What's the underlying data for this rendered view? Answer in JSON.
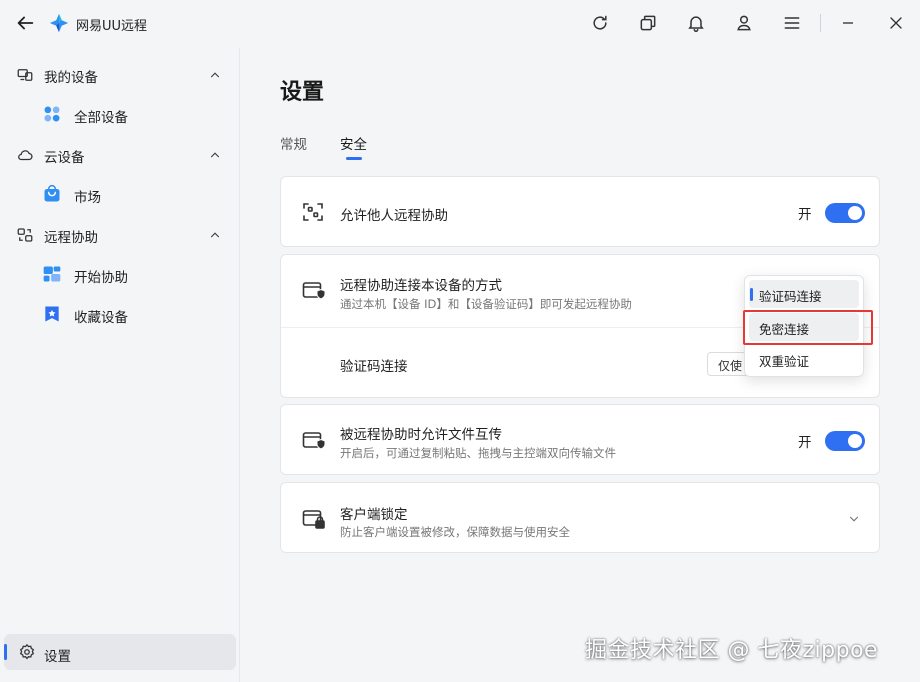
{
  "app": {
    "title": "网易UU远程"
  },
  "sidebar": {
    "groups": [
      {
        "label": "我的设备",
        "items": [
          {
            "label": "全部设备"
          }
        ]
      },
      {
        "label": "云设备",
        "items": [
          {
            "label": "市场"
          }
        ]
      },
      {
        "label": "远程协助",
        "items": [
          {
            "label": "开始协助"
          },
          {
            "label": "收藏设备"
          }
        ]
      }
    ],
    "settings_label": "设置"
  },
  "main": {
    "title": "设置",
    "tabs": [
      {
        "label": "常规",
        "active": false
      },
      {
        "label": "安全",
        "active": true
      }
    ],
    "cards": {
      "allow_remote": {
        "title": "允许他人远程协助",
        "toggle_label": "开",
        "enabled": true
      },
      "connect_method": {
        "title": "远程协助连接本设备的方式",
        "desc": "通过本机【设备 ID】和【设备验证码】即可发起远程协助",
        "sub_row_label": "验证码连接",
        "select_value": "仅使",
        "dropdown_options": [
          {
            "label": "验证码连接",
            "selected": true
          },
          {
            "label": "免密连接",
            "hovered": true
          },
          {
            "label": "双重验证"
          }
        ]
      },
      "file_transfer": {
        "title": "被远程协助时允许文件互传",
        "desc": "开启后，可通过复制粘贴、拖拽与主控端双向传输文件",
        "toggle_label": "开",
        "enabled": true
      },
      "client_lock": {
        "title": "客户端锁定",
        "desc": "防止客户端设置被修改，保障数据与使用安全"
      }
    }
  },
  "watermark": "掘金技术社区 @ 七夜zippoe",
  "colors": {
    "accent": "#2f6ff2",
    "highlight": "#e53935"
  }
}
